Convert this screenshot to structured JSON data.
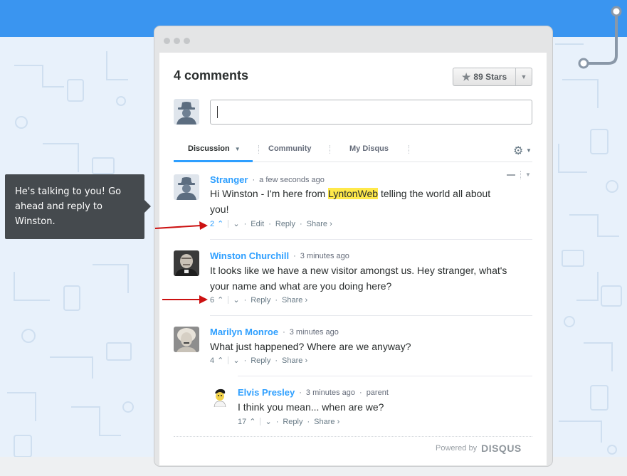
{
  "page": {
    "colors": {
      "top_band": "#3a95f0",
      "background": "#e8f1fb",
      "accent": "#2e9fff",
      "tooltip": "#454a4e",
      "arrow": "#cc1111",
      "highlight": "#ffe94a"
    }
  },
  "header": {
    "title": "4 comments",
    "stars_label": "89 Stars",
    "stars_icon": "star-icon",
    "stars_dropdown_icon": "caret-down-icon"
  },
  "composer": {
    "avatar_icon": "anonymous-user-icon",
    "placeholder": ""
  },
  "tabs": [
    {
      "label": "Discussion",
      "active": true,
      "has_dropdown": true
    },
    {
      "label": "Community",
      "active": false
    },
    {
      "label": "My Disqus",
      "active": false
    }
  ],
  "settings_icon": "gear-icon",
  "tooltip": {
    "text": "He's talking to you! Go ahead and reply to Winston."
  },
  "comments": [
    {
      "author": "Stranger",
      "time": "a few seconds ago",
      "text_before": "Hi Winston - I'm here from ",
      "highlight": "LyntonWeb",
      "text_after": " telling the world all about you!",
      "votes": "2",
      "edit_label": "Edit",
      "reply_label": "Reply",
      "share_label": "Share ›",
      "avatar_icon": "anonymous-user-icon"
    },
    {
      "author": "Winston Churchill",
      "time": "3 minutes ago",
      "text": "It looks like we have a new visitor amongst us. Hey stranger, what's your name and what are you doing here?",
      "votes": "6",
      "reply_label": "Reply",
      "share_label": "Share ›",
      "avatar_icon": "winston-photo-icon"
    },
    {
      "author": "Marilyn Monroe",
      "time": "3 minutes ago",
      "text": "What just happened? Where are we anyway?",
      "votes": "4",
      "reply_label": "Reply",
      "share_label": "Share ›",
      "avatar_icon": "marilyn-photo-icon"
    },
    {
      "author": "Elvis Presley",
      "time": "3 minutes ago",
      "parent_label": "parent",
      "text": "I think you mean... when are we?",
      "votes": "17",
      "reply_label": "Reply",
      "share_label": "Share ›",
      "avatar_icon": "elvis-cartoon-icon"
    }
  ],
  "footer": {
    "powered_by": "Powered by",
    "brand": "DISQUS"
  },
  "separators": {
    "dot": "·"
  }
}
